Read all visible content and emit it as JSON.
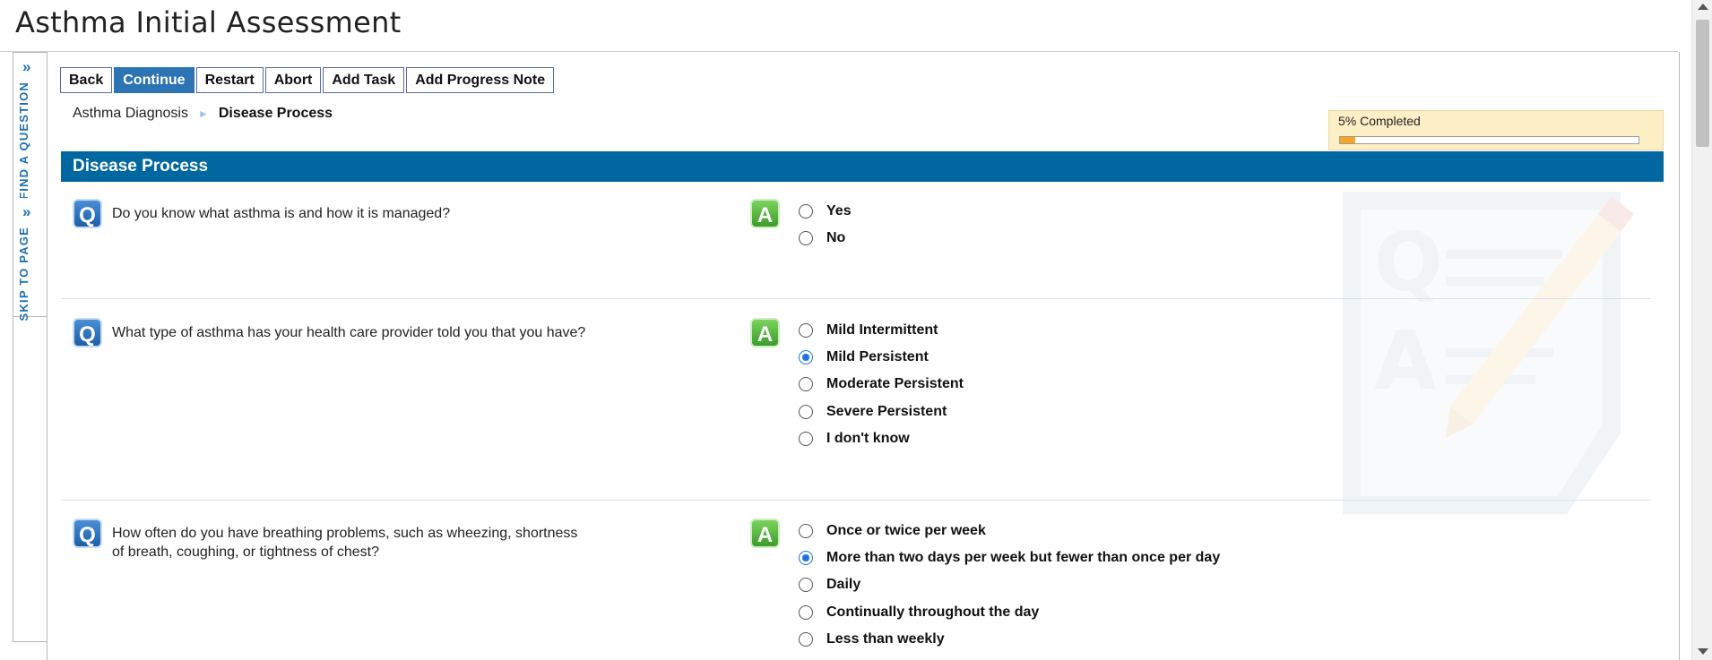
{
  "page": {
    "title": "Asthma Initial Assessment"
  },
  "side_tabs": {
    "find_question": "FIND A QUESTION",
    "skip_to_page": "SKIP TO PAGE",
    "chevron": "»"
  },
  "toolbar": {
    "back": "Back",
    "continue": "Continue",
    "restart": "Restart",
    "abort": "Abort",
    "add_task": "Add Task",
    "add_progress_note": "Add Progress Note"
  },
  "breadcrumb": {
    "parent": "Asthma Diagnosis",
    "current": "Disease Process"
  },
  "progress": {
    "label": "5% Completed",
    "percent": 5
  },
  "section": {
    "title": "Disease Process"
  },
  "icons": {
    "question": "Q",
    "answer": "A"
  },
  "questions": [
    {
      "text": "Do you know what asthma is and how it is managed?",
      "options": [
        {
          "label": "Yes",
          "checked": false
        },
        {
          "label": "No",
          "checked": false
        }
      ]
    },
    {
      "text": "What type of asthma has your health care provider told you that you have?",
      "options": [
        {
          "label": "Mild Intermittent",
          "checked": false
        },
        {
          "label": "Mild Persistent",
          "checked": true
        },
        {
          "label": "Moderate Persistent",
          "checked": false
        },
        {
          "label": "Severe Persistent",
          "checked": false
        },
        {
          "label": "I don't know",
          "checked": false
        }
      ]
    },
    {
      "text_line1": "How often do you have breathing problems, such as wheezing, shortness",
      "text_line2": "of breath, coughing, or tightness of chest?",
      "options": [
        {
          "label": "Once or twice per week",
          "checked": false
        },
        {
          "label": "More than two days per week but fewer than once per day",
          "checked": true
        },
        {
          "label": "Daily",
          "checked": false
        },
        {
          "label": "Continually throughout the day",
          "checked": false
        },
        {
          "label": "Less than weekly",
          "checked": false
        }
      ]
    }
  ],
  "colors": {
    "section_bar": "#0067a0",
    "primary_button": "#2d74b5",
    "progress_fill": "#f5a623",
    "accent_blue": "#1e6fb0"
  }
}
